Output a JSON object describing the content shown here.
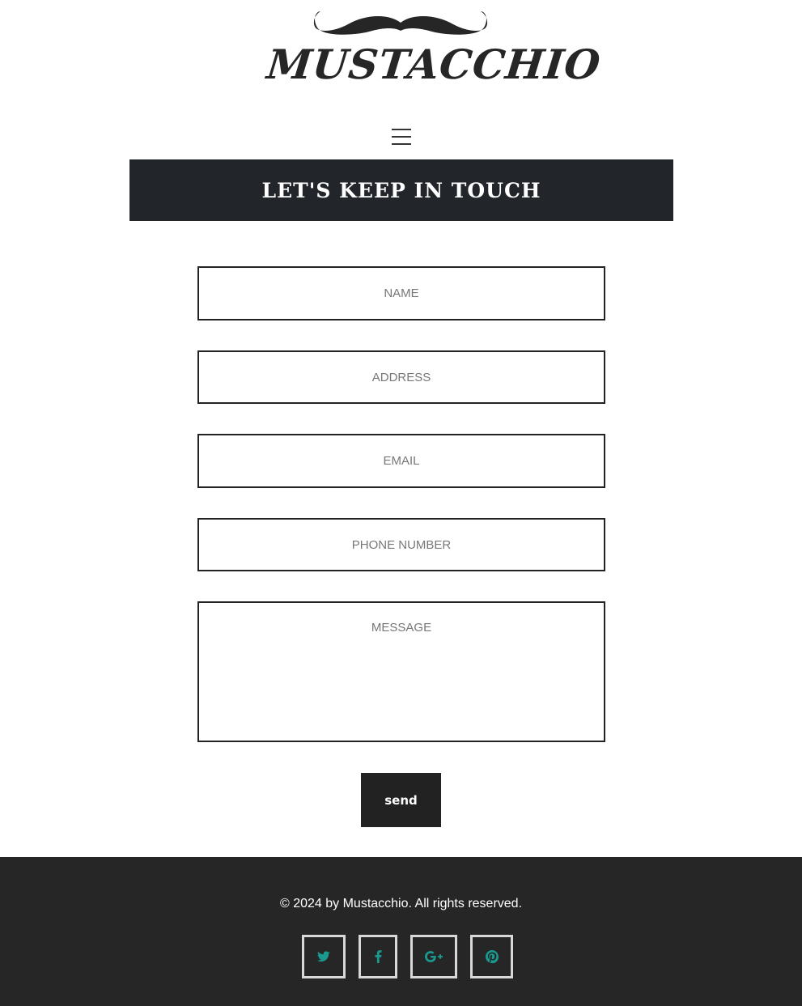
{
  "brand": {
    "name": "MUSTACCHIO"
  },
  "menu": {
    "icon": "hamburger-menu-icon"
  },
  "contact": {
    "heading": "LET'S KEEP IN TOUCH",
    "fields": {
      "name_placeholder": "NAME",
      "address_placeholder": "ADDRESS",
      "email_placeholder": "EMAIL",
      "phone_placeholder": "PHONE NUMBER",
      "message_placeholder": "MESSAGE"
    },
    "send_label": "send"
  },
  "footer": {
    "copyright": "© 2024 by Mustacchio. All rights reserved.",
    "social": [
      "twitter-icon",
      "facebook-icon",
      "google-plus-icon",
      "pinterest-icon"
    ]
  },
  "colors": {
    "dark_band": "#222529",
    "footer_bg": "#262626",
    "social_icon": "#1a9a8e",
    "social_border": "#d8d8d8"
  }
}
